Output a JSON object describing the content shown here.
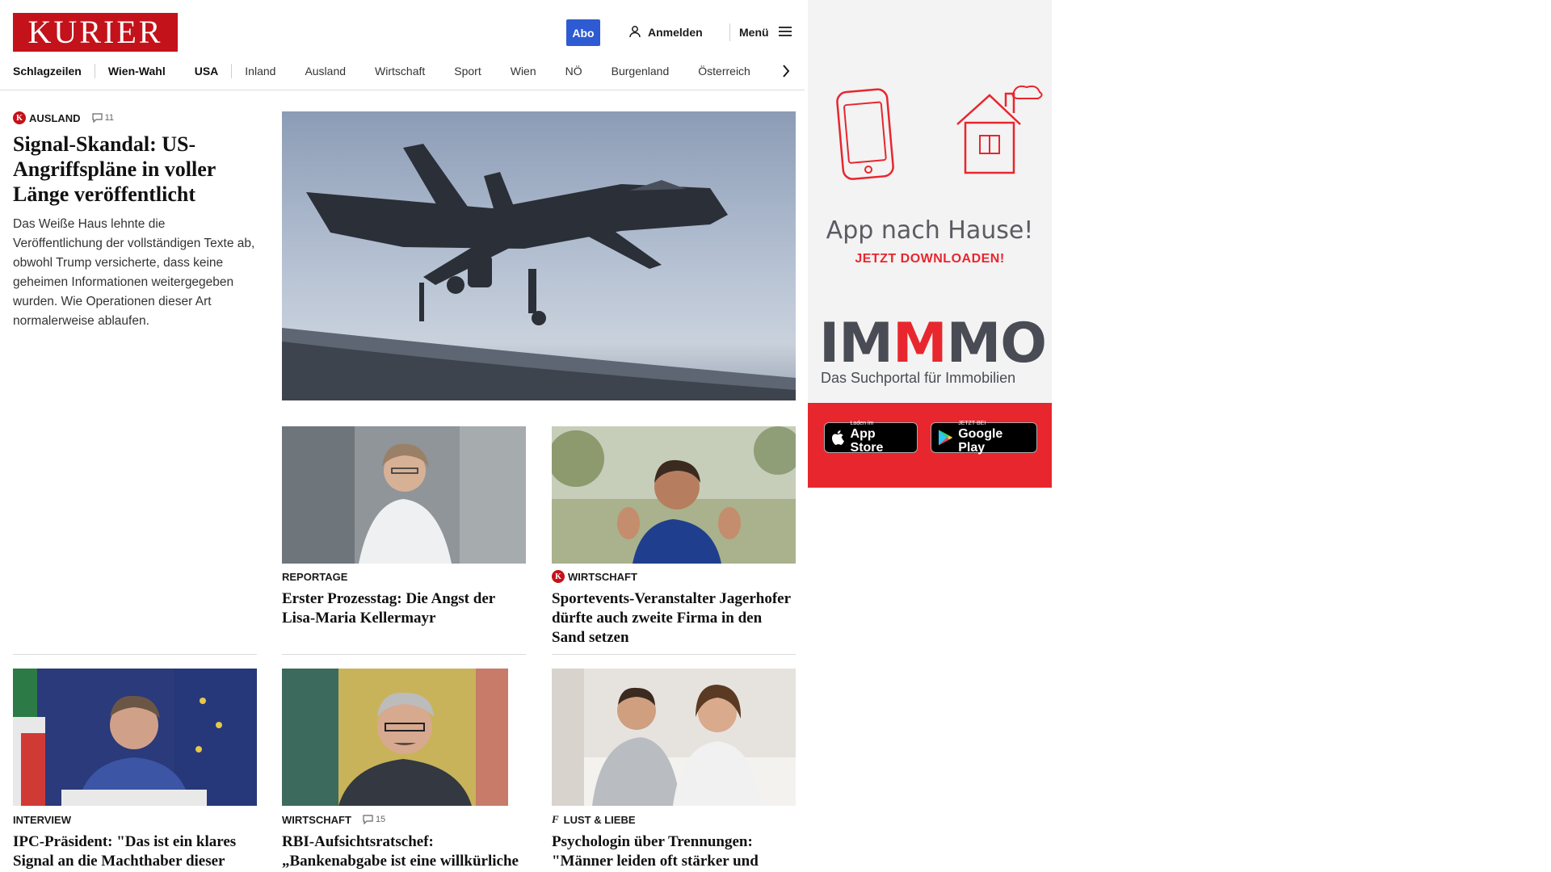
{
  "header": {
    "logo": "KURIER",
    "abo_label": "Abo",
    "login_label": "Anmelden",
    "menu_label": "Menü"
  },
  "nav": {
    "items": [
      "Schlagzeilen",
      "Wien-Wahl",
      "USA",
      "Inland",
      "Ausland",
      "Wirtschaft",
      "Sport",
      "Wien",
      "NÖ",
      "Burgenland",
      "Österreich"
    ]
  },
  "lead": {
    "kicker": "Ausland",
    "comments": "11",
    "title": "Signal-Skandal: US-Angriffspläne in voller Länge veröffentlicht",
    "description": "Das Weiße Haus lehnte die Veröffentlichung der vollständigen Texte ab, obwohl Trump versicherte, dass keine geheimen Informationen weitergegeben wurden. Wie Operationen dieser Art normalerweise ablaufen."
  },
  "teasers": [
    {
      "kicker": "Reportage",
      "title": "Erster Prozesstag: Die Angst der Lisa-Maria Kellermayr",
      "badge": ""
    },
    {
      "kicker": "Wirtschaft",
      "title": "Sportevents-Veranstalter Jagerhofer dürfte auch zweite Firma in den Sand setzen",
      "badge": "K"
    },
    {
      "kicker": "Interview",
      "title": "IPC-Präsident: \"Das ist ein klares Signal an die Machthaber dieser Welt\"",
      "badge": ""
    },
    {
      "kicker": "Wirtschaft",
      "title": "RBI-Aufsichtsratschef: „Bankenabgabe ist eine willkürliche Maßnahme“",
      "badge": "",
      "comments": "15"
    },
    {
      "kicker": "Lust & Liebe",
      "title": "Psychologin über Trennungen: \"Männer leiden oft stärker und länger\"",
      "badge": "f"
    }
  ],
  "ad": {
    "title": "App nach Hause!",
    "subtitle": "JETZT DOWNLOADEN!",
    "brand_pre": "IM",
    "brand_accent": "M",
    "brand_post": "MO",
    "brand_sub": "Das Suchportal für Immobilien",
    "appstore_small": "Laden im",
    "appstore_big": "App Store",
    "googleplay_small": "JETZT BEI",
    "googleplay_big": "Google Play"
  },
  "colors": {
    "brand": "#c4121b",
    "abo": "#2e5bd2",
    "ad_red": "#e8262e"
  }
}
